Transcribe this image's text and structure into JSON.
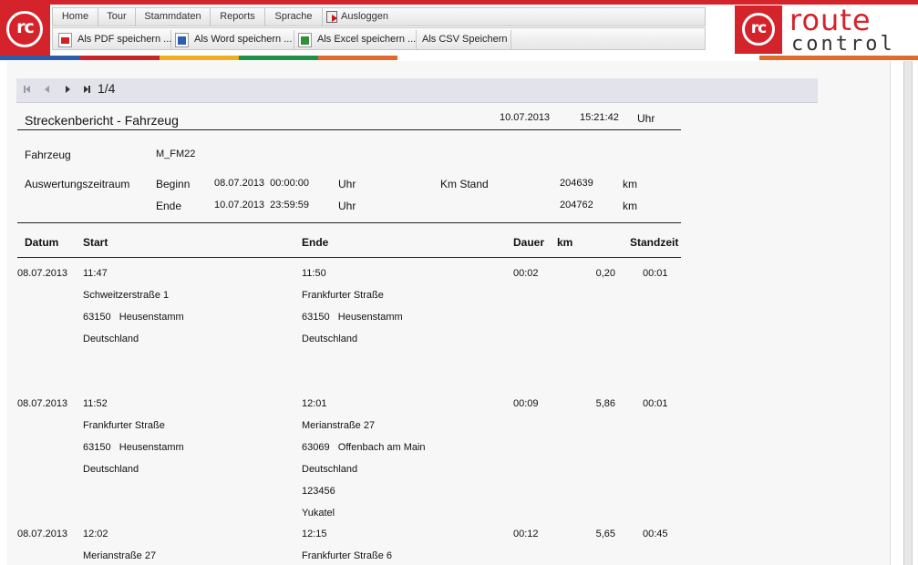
{
  "logo_small": {
    "text": "rc"
  },
  "menu": {
    "home": "Home",
    "tour": "Tour",
    "stammdaten": "Stammdaten",
    "reports": "Reports",
    "sprache": "Sprache",
    "logout": "Ausloggen"
  },
  "export": {
    "pdf": "Als PDF speichern ...",
    "word": "Als Word speichern ...",
    "excel": "Als Excel speichern ...",
    "csv": "Als CSV Speichern"
  },
  "brand": {
    "mark": "rc",
    "word1": "route",
    "word2": "control"
  },
  "stripe_colors": [
    "#2a5ea8",
    "#c9262c",
    "#f0ad1c",
    "#1f8f49",
    "#e06a2c"
  ],
  "pager": {
    "page": "1/4"
  },
  "report": {
    "title": "Streckenbericht - Fahrzeug",
    "date": "10.07.2013",
    "time": "15:21:42",
    "time_unit": "Uhr",
    "vehicle_label": "Fahrzeug",
    "vehicle_value": "M_FM22",
    "period_label": "Auswertungszeitraum",
    "begin_label": "Beginn",
    "begin_value": "08.07.2013  00:00:00",
    "begin_unit": "Uhr",
    "end_label": "Ende",
    "end_value": "10.07.2013  23:59:59",
    "end_unit": "Uhr",
    "km_label": "Km Stand",
    "km_begin": "204639",
    "km_begin_unit": "km",
    "km_end": "204762",
    "km_end_unit": "km"
  },
  "columns": {
    "datum": "Datum",
    "start": "Start",
    "ende": "Ende",
    "dauer": "Dauer",
    "km": "km",
    "standzeit": "Standzeit"
  },
  "rows": [
    {
      "datum": "08.07.2013",
      "start_time": "11:47",
      "start_lines": [
        "Schweitzerstraße 1",
        "63150   Heusenstamm",
        "Deutschland"
      ],
      "end_time": "11:50",
      "end_lines": [
        "Frankfurter Straße",
        "63150   Heusenstamm",
        "Deutschland"
      ],
      "dauer": "00:02",
      "km": "0,20",
      "standzeit": "00:01"
    },
    {
      "datum": "08.07.2013",
      "start_time": "11:52",
      "start_lines": [
        "Frankfurter Straße",
        "63150   Heusenstamm",
        "Deutschland"
      ],
      "end_time": "12:01",
      "end_lines": [
        "Merianstraße 27",
        "63069   Offenbach am Main",
        "Deutschland",
        "123456",
        "Yukatel"
      ],
      "dauer": "00:09",
      "km": "5,86",
      "standzeit": "00:01"
    },
    {
      "datum": "08.07.2013",
      "start_time": "12:02",
      "start_lines": [
        "Merianstraße 27"
      ],
      "end_time": "12:15",
      "end_lines": [
        "Frankfurter Straße 6"
      ],
      "dauer": "00:12",
      "km": "5,65",
      "standzeit": "00:45"
    }
  ]
}
